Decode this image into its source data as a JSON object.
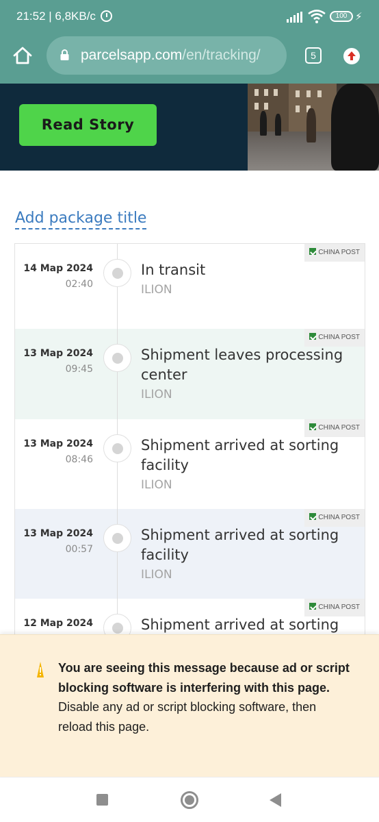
{
  "status_bar": {
    "time": "21:52 | 6,8KB/с",
    "battery": "100"
  },
  "browser": {
    "url_host": "parcelsapp.com",
    "url_path": "/en/tracking/",
    "tab_count": "5"
  },
  "banner": {
    "button_label": "Read Story"
  },
  "tracking": {
    "add_title_label": "Add package title",
    "events": [
      {
        "date": "14 Мар 2024",
        "time": "02:40",
        "status": "In transit",
        "location": "ILION",
        "carrier": "CHINA POST"
      },
      {
        "date": "13 Мар 2024",
        "time": "09:45",
        "status": "Shipment leaves processing center",
        "location": "ILION",
        "carrier": "CHINA POST"
      },
      {
        "date": "13 Мар 2024",
        "time": "08:46",
        "status": "Shipment arrived at sorting facility",
        "location": "ILION",
        "carrier": "CHINA POST"
      },
      {
        "date": "13 Мар 2024",
        "time": "00:57",
        "status": "Shipment arrived at sorting facility",
        "location": "ILION",
        "carrier": "CHINA POST"
      },
      {
        "date": "12 Мар 2024",
        "time": "",
        "status": "Shipment arrived at sorting",
        "location": "",
        "carrier": "CHINA POST"
      }
    ]
  },
  "adblock_notice": {
    "bold_text": "You are seeing this message because ad or script blocking software is interfering with this page.",
    "body_text": "Disable any ad or script blocking software, then reload this page."
  },
  "colors": {
    "browser_bar": "#5a9e92",
    "banner_background": "#0f2a3c",
    "read_story_button": "#4fd44a",
    "link": "#3b7bbf",
    "notice_background": "#fdf0d9",
    "row_alt_background": "#eef6f3",
    "row_alt_background_2": "#eef2f8"
  }
}
